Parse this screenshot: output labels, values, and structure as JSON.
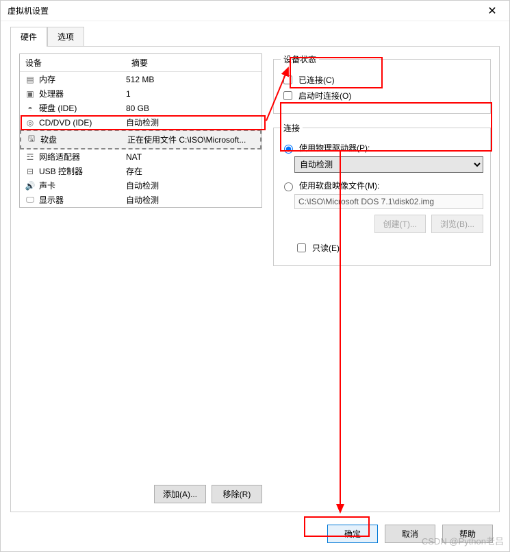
{
  "window": {
    "title": "虚拟机设置",
    "close": "✕"
  },
  "tabs": {
    "hardware": "硬件",
    "options": "选项"
  },
  "table": {
    "header_device": "设备",
    "header_summary": "摘要",
    "rows": [
      {
        "icon": "▤",
        "name": "内存",
        "summary": "512 MB"
      },
      {
        "icon": "▣",
        "name": "处理器",
        "summary": "1"
      },
      {
        "icon": "◓",
        "name": "硬盘 (IDE)",
        "summary": "80 GB"
      },
      {
        "icon": "◎",
        "name": "CD/DVD (IDE)",
        "summary": "自动检测"
      },
      {
        "icon": "🖫",
        "name": "软盘",
        "summary": "正在使用文件 C:\\ISO\\Microsoft..."
      },
      {
        "icon": "☲",
        "name": "网络适配器",
        "summary": "NAT"
      },
      {
        "icon": "⊟",
        "name": "USB 控制器",
        "summary": "存在"
      },
      {
        "icon": "🔊",
        "name": "声卡",
        "summary": "自动检测"
      },
      {
        "icon": "🖵",
        "name": "显示器",
        "summary": "自动检测"
      }
    ]
  },
  "left_buttons": {
    "add": "添加(A)...",
    "remove": "移除(R)"
  },
  "status": {
    "legend": "设备状态",
    "connected": "已连接(C)",
    "connect_at_poweron": "启动时连接(O)"
  },
  "connection": {
    "legend": "连接",
    "use_physical": "使用物理驱动器(P):",
    "autodetect": "自动检测",
    "use_image": "使用软盘映像文件(M):",
    "image_path": "C:\\ISO\\Microsoft DOS 7.1\\disk02.img",
    "create": "创建(T)...",
    "browse": "浏览(B)...",
    "readonly": "只读(E)"
  },
  "footer": {
    "ok": "确定",
    "cancel": "取消",
    "help": "帮助"
  },
  "watermark": "CSDN @Python老吕"
}
